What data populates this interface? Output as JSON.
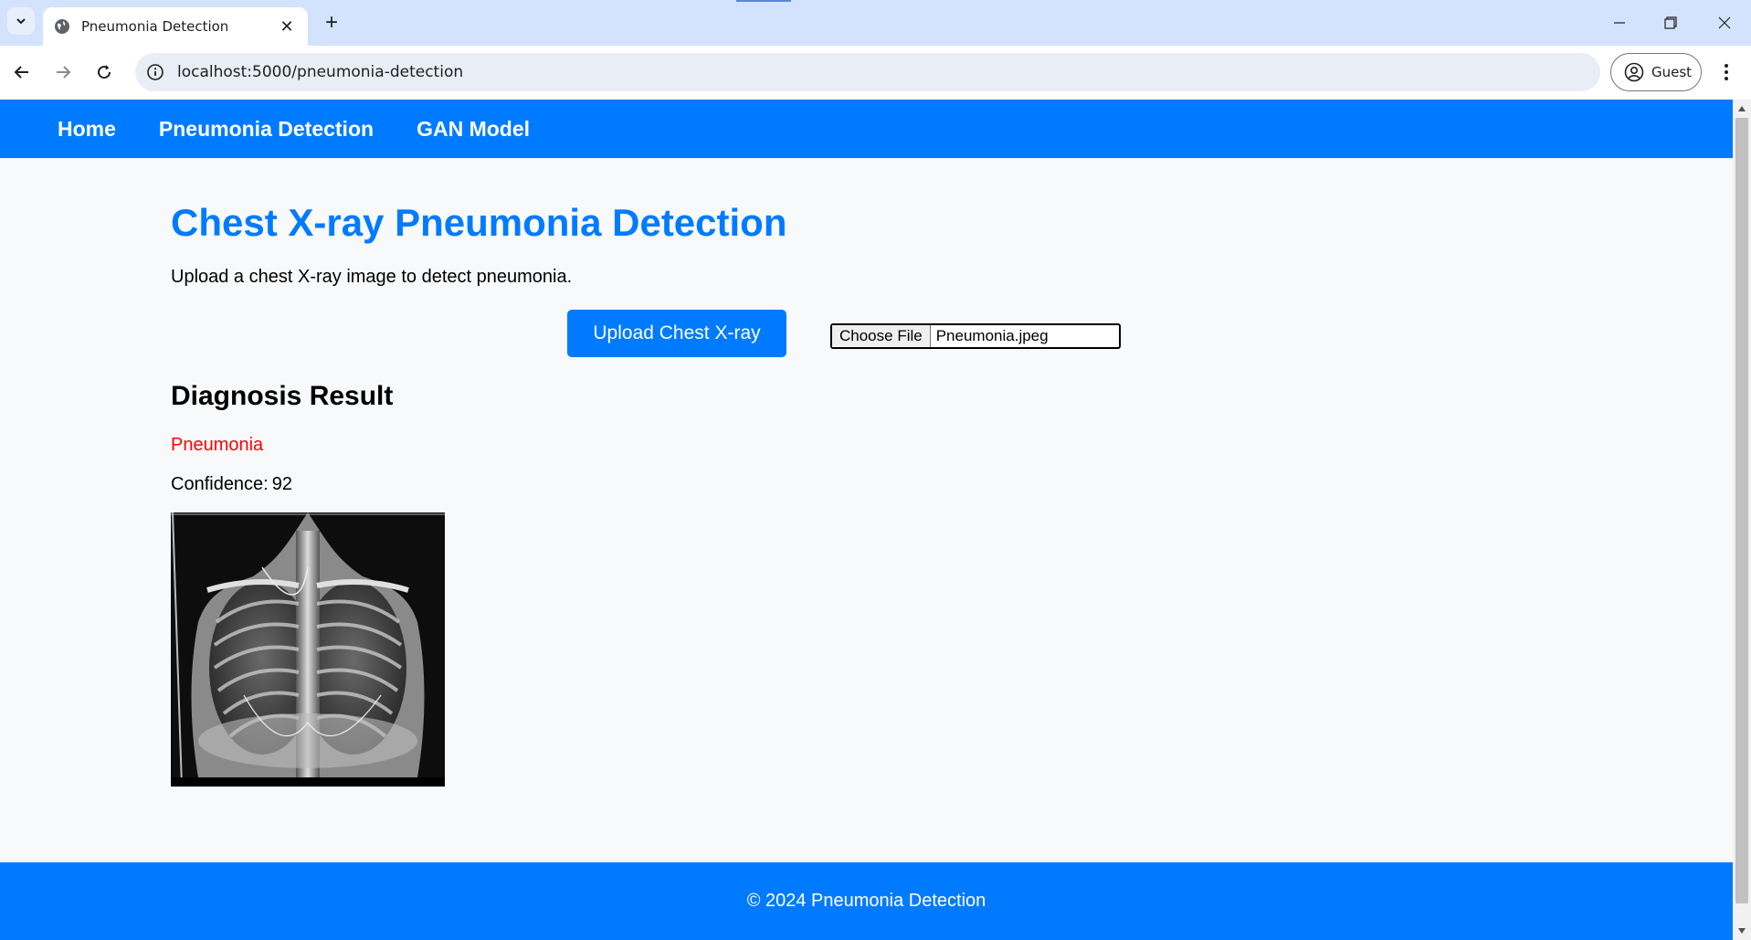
{
  "browser": {
    "tab_title": "Pneumonia Detection",
    "url": "localhost:5000/pneumonia-detection",
    "profile_label": "Guest",
    "icons": [
      "tab-list-icon",
      "globe-icon",
      "close-icon",
      "plus-icon",
      "minimize-icon",
      "restore-icon",
      "window-close-icon",
      "back-arrow-icon",
      "forward-arrow-icon",
      "reload-icon",
      "info-icon",
      "person-icon",
      "more-vert-icon"
    ]
  },
  "site": {
    "brand_color": "#007bff",
    "nav": [
      {
        "label": "Home"
      },
      {
        "label": "Pneumonia Detection"
      },
      {
        "label": "GAN Model"
      }
    ],
    "title": "Chest X-ray Pneumonia Detection",
    "intro": "Upload a chest X-ray image to detect pneumonia.",
    "upload_button": "Upload Chest X-ray",
    "file_input": {
      "button_label": "Choose File",
      "file_name": "Pneumonia.jpeg"
    },
    "result": {
      "heading": "Diagnosis Result",
      "label": "Pneumonia",
      "label_color": "#ff0000",
      "confidence_label": "Confidence:",
      "confidence_value": "92"
    },
    "footer": "© 2024 Pneumonia Detection"
  }
}
